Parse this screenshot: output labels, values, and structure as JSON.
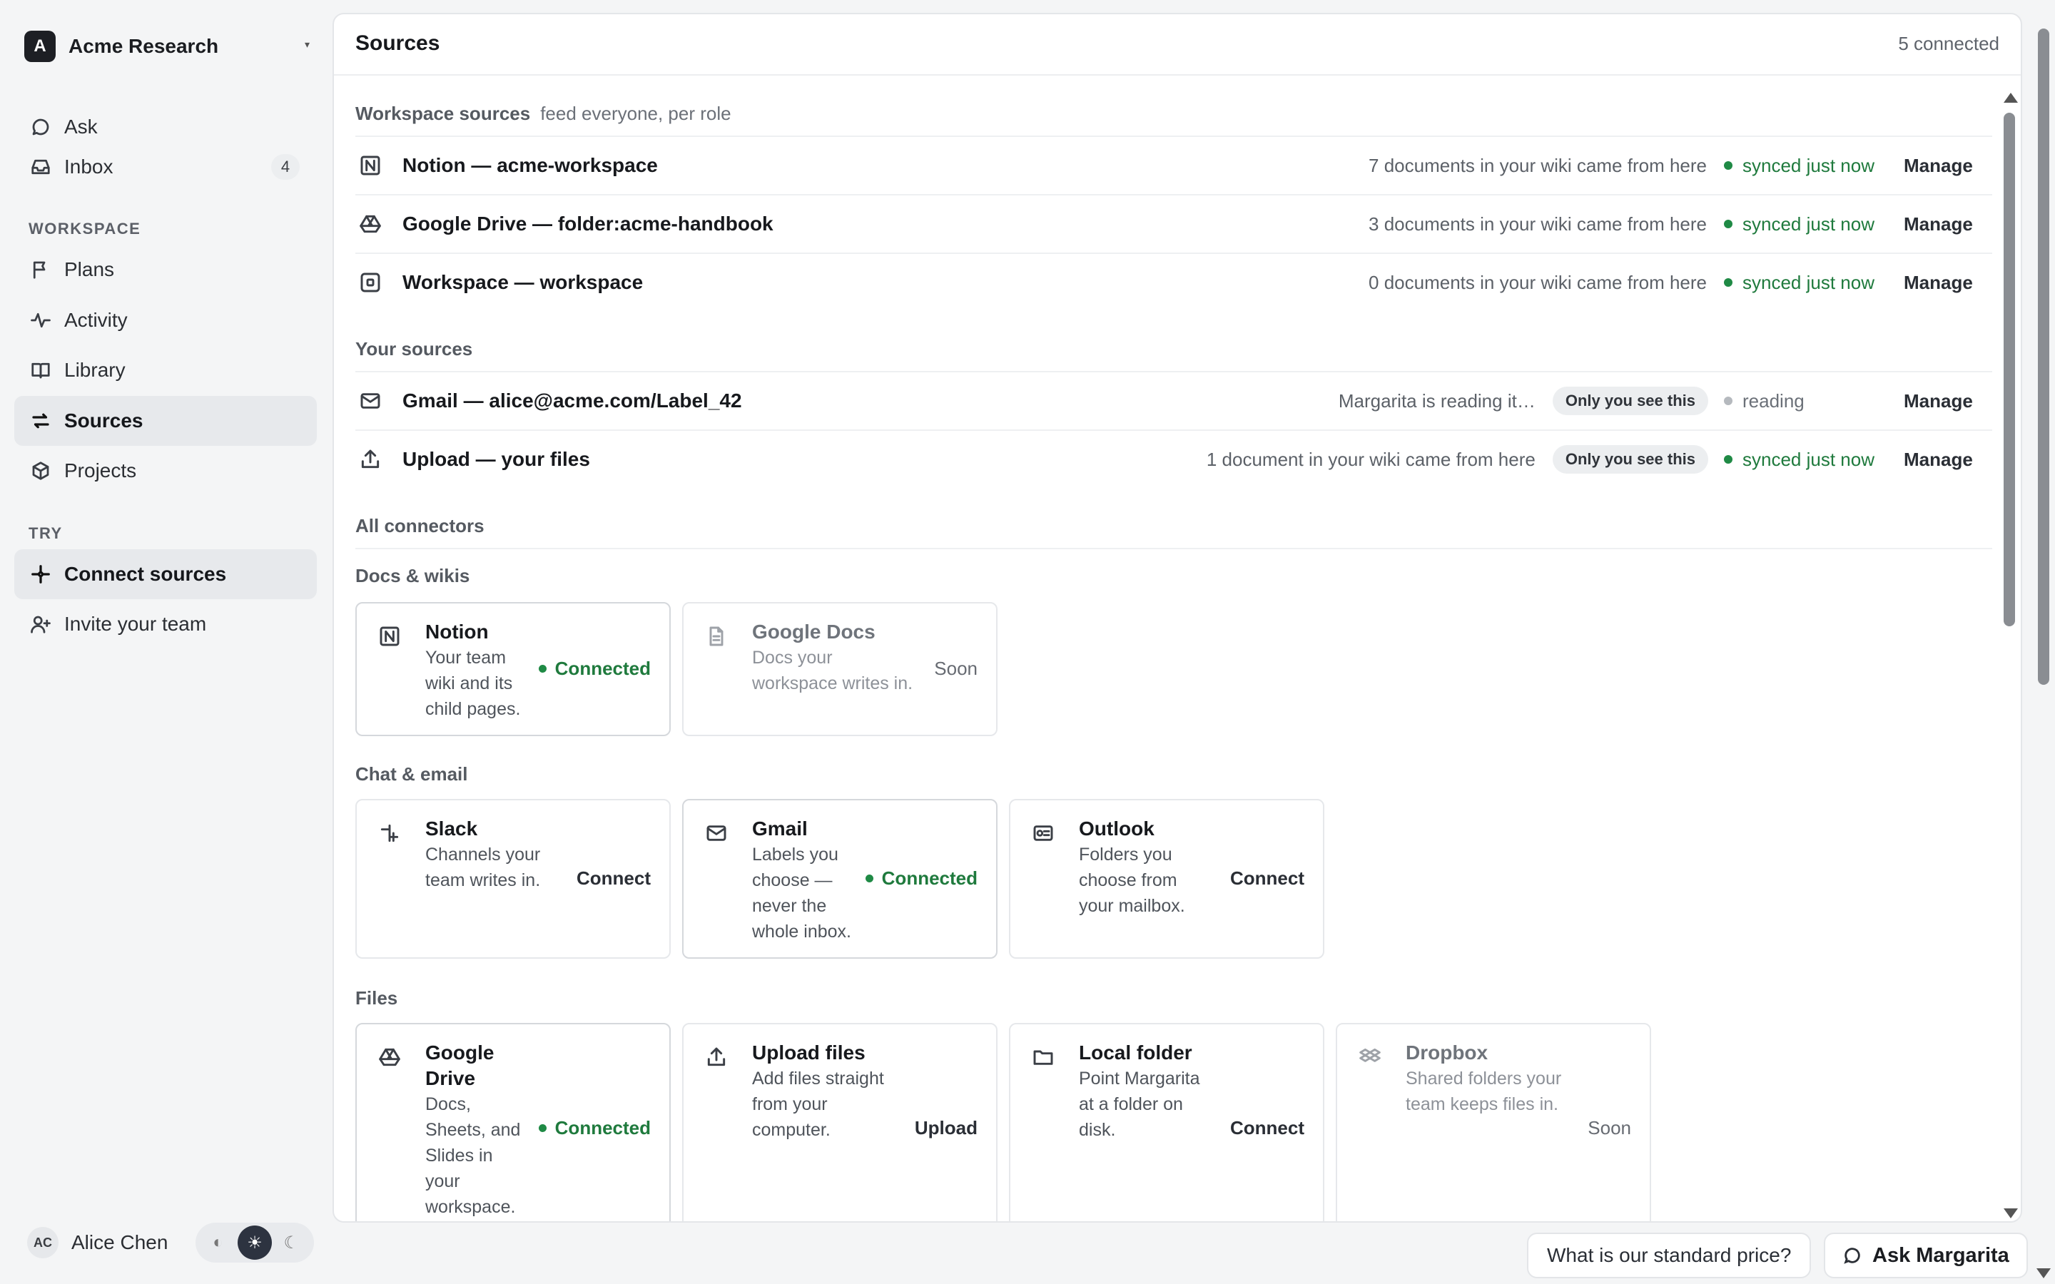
{
  "workspace": {
    "initial": "A",
    "name": "Acme Research"
  },
  "nav": {
    "ask": "Ask",
    "inbox": "Inbox",
    "inbox_count": "4",
    "workspace_section": "WORKSPACE",
    "plans": "Plans",
    "activity": "Activity",
    "library": "Library",
    "sources": "Sources",
    "projects": "Projects",
    "try_section": "TRY",
    "connect_sources": "Connect sources",
    "invite_team": "Invite your team"
  },
  "user": {
    "initials": "AC",
    "name": "Alice Chen"
  },
  "theme": {
    "options": [
      "contrast",
      "light",
      "dark"
    ],
    "selected": "light"
  },
  "main": {
    "title": "Sources",
    "connected_count": "5 connected",
    "workspace_sources": {
      "label": "Workspace sources",
      "sublabel": "feed everyone, per role",
      "rows": [
        {
          "icon": "notion-icon",
          "name": "Notion — acme-workspace",
          "docs": "7 documents in your wiki came from here",
          "status": "synced just now",
          "action": "Manage"
        },
        {
          "icon": "google-drive-icon",
          "name": "Google Drive — folder:acme-handbook",
          "docs": "3 documents in your wiki came from here",
          "status": "synced just now",
          "action": "Manage"
        },
        {
          "icon": "workspace-icon",
          "name": "Workspace — workspace",
          "docs": "0 documents in your wiki came from here",
          "status": "synced just now",
          "action": "Manage"
        }
      ]
    },
    "your_sources": {
      "label": "Your sources",
      "rows": [
        {
          "icon": "mail-icon",
          "name": "Gmail — alice@acme.com/Label_42",
          "docs": "Margarita is reading it…",
          "pill": "Only you see this",
          "status": "reading",
          "action": "Manage"
        },
        {
          "icon": "upload-icon",
          "name": "Upload — your files",
          "docs": "1 document in your wiki came from here",
          "pill": "Only you see this",
          "status": "synced just now",
          "action": "Manage"
        }
      ]
    },
    "all_connectors": {
      "label": "All connectors",
      "categories": [
        {
          "label": "Docs & wikis",
          "cards": [
            {
              "icon": "notion-icon",
              "title": "Notion",
              "desc": [
                "Your team",
                "wiki and its",
                "child pages."
              ],
              "action": "Connected",
              "state": "connected"
            },
            {
              "icon": "document-icon",
              "title": "Google Docs",
              "desc": [
                "Docs your",
                "workspace writes in."
              ],
              "action": "Soon",
              "state": "soon"
            }
          ]
        },
        {
          "label": "Chat & email",
          "cards": [
            {
              "icon": "slack-icon",
              "title": "Slack",
              "desc": [
                "Channels your",
                "team writes in."
              ],
              "action": "Connect",
              "state": "available"
            },
            {
              "icon": "mail-icon",
              "title": "Gmail",
              "desc": [
                "Labels you",
                "choose —",
                "never the",
                "whole inbox."
              ],
              "action": "Connected",
              "state": "connected"
            },
            {
              "icon": "outlook-icon",
              "title": "Outlook",
              "desc": [
                "Folders you",
                "choose from",
                "your mailbox."
              ],
              "action": "Connect",
              "state": "available"
            }
          ]
        },
        {
          "label": "Files",
          "cards": [
            {
              "icon": "google-drive-icon",
              "title": "Google Drive",
              "desc": [
                "Docs,",
                "Sheets, and",
                "Slides in",
                "your",
                "workspace."
              ],
              "action": "Connected",
              "state": "connected"
            },
            {
              "icon": "upload-icon",
              "title": "Upload files",
              "desc": [
                "Add files straight",
                "from your",
                "computer."
              ],
              "action": "Upload",
              "state": "available"
            },
            {
              "icon": "folder-icon",
              "title": "Local folder",
              "desc": [
                "Point Margarita",
                "at a folder on",
                "disk."
              ],
              "action": "Connect",
              "state": "available"
            },
            {
              "icon": "dropbox-icon",
              "title": "Dropbox",
              "desc": [
                "Shared folders your",
                "team keeps files in."
              ],
              "action": "Soon",
              "state": "soon"
            }
          ]
        }
      ]
    }
  },
  "bottom": {
    "suggestion": "What is our standard price?",
    "ask_button": "Ask Margarita"
  },
  "colors": {
    "accent_green": "#1f7a3d",
    "sidebar_bg": "#f4f5f6",
    "active_bg": "#e7e9ec"
  }
}
